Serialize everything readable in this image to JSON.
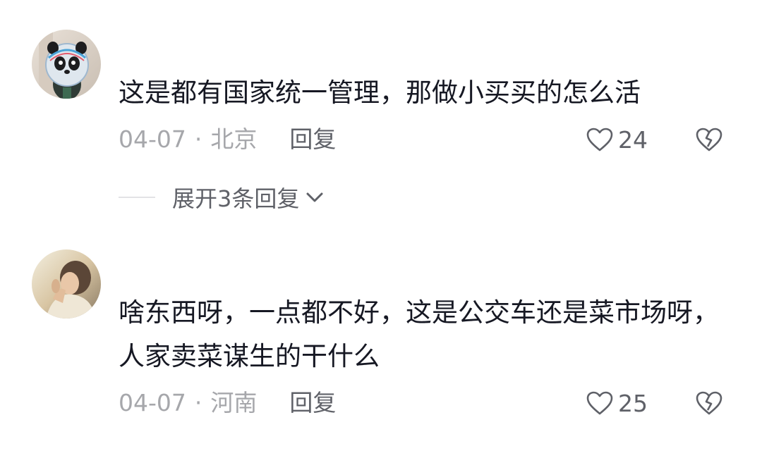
{
  "comments": [
    {
      "text": "这是都有国家统一管理，那做小买买的怎么活",
      "date": "04-07",
      "separator": "·",
      "location": "北京",
      "reply_label": "回复",
      "likes": "24",
      "avatar_icon": "panda-avatar-icon",
      "expand_label": "展开3条回复"
    },
    {
      "text": "啥东西呀，一点都不好，这是公交车还是菜市场呀，人家卖菜谋生的干什么",
      "date": "04-07",
      "separator": "·",
      "location": "河南",
      "reply_label": "回复",
      "likes": "25",
      "avatar_icon": "photo-avatar-icon"
    }
  ],
  "colors": {
    "primary_text": "#161823",
    "meta_text": "#a6a7ab",
    "action_text": "#5f6168"
  }
}
